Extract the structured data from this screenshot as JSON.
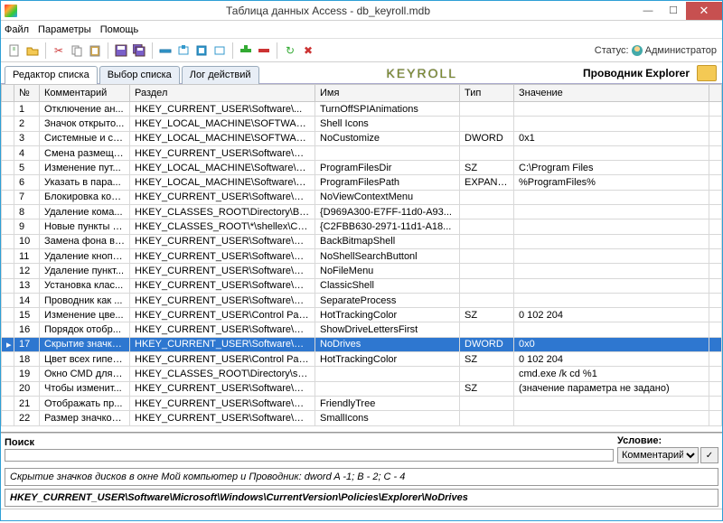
{
  "window": {
    "title": "Таблица данных Access - db_keyroll.mdb"
  },
  "menu": {
    "file": "Файл",
    "params": "Параметры",
    "help": "Помощь"
  },
  "status": {
    "label": "Статус:",
    "user": "Администратор"
  },
  "tabs": {
    "editor": "Редактор списка",
    "select": "Выбор списка",
    "log": "Лог действий"
  },
  "brand": "KEYROLL",
  "explorer_label": "Проводник Explorer",
  "columns": {
    "num": "№",
    "comment": "Комментарий",
    "section": "Раздел",
    "name": "Имя",
    "type": "Тип",
    "value": "Значение"
  },
  "rows": [
    {
      "n": "1",
      "com": "Отключение ан...",
      "sec": "HKEY_CURRENT_USER\\Software\\...",
      "name": "TurnOffSPIAnimations",
      "type": "",
      "val": ""
    },
    {
      "n": "2",
      "com": "Значок открыто...",
      "sec": "HKEY_LOCAL_MACHINE\\SOFTWARE\\...",
      "name": "Shell Icons",
      "type": "",
      "val": ""
    },
    {
      "n": "3",
      "com": "Системные и сп...",
      "sec": "HKEY_LOCAL_MACHINE\\SOFTWARE\\...",
      "name": "NoCustomize",
      "type": "DWORD",
      "val": "0x1"
    },
    {
      "n": "4",
      "com": "Смена размеще...",
      "sec": "HKEY_CURRENT_USER\\Software\\Mic...",
      "name": "",
      "type": "",
      "val": ""
    },
    {
      "n": "5",
      "com": "Изменение пут...",
      "sec": "HKEY_LOCAL_MACHINE\\Software\\Mic...",
      "name": "ProgramFilesDir",
      "type": "SZ",
      "val": "C:\\Program Files"
    },
    {
      "n": "6",
      "com": "Указать в пара...",
      "sec": "HKEY_LOCAL_MACHINE\\Software\\Mic...",
      "name": "ProgramFilesPath",
      "type": "EXPAND...",
      "val": "%ProgramFiles%"
    },
    {
      "n": "7",
      "com": "Блокировка кон...",
      "sec": "HKEY_CURRENT_USER\\Software\\Mic...",
      "name": "NoViewContextMenu",
      "type": "",
      "val": ""
    },
    {
      "n": "8",
      "com": "Удаление кома...",
      "sec": "HKEY_CLASSES_ROOT\\Directory\\Bac...",
      "name": "{D969A300-E7FF-11d0-A93...",
      "type": "",
      "val": ""
    },
    {
      "n": "9",
      "com": "Новые пункты К...",
      "sec": "HKEY_CLASSES_ROOT\\*\\shellex\\Cont...",
      "name": "{C2FBB630-2971-11d1-A18...",
      "type": "",
      "val": ""
    },
    {
      "n": "10",
      "com": "Замена фона в ...",
      "sec": "HKEY_CURRENT_USER\\Software\\Mic...",
      "name": "BackBitmapShell",
      "type": "",
      "val": ""
    },
    {
      "n": "11",
      "com": "Удаление кнопк...",
      "sec": "HKEY_CURRENT_USER\\Software\\Mic...",
      "name": "NoShellSearchButtonl",
      "type": "",
      "val": ""
    },
    {
      "n": "12",
      "com": "Удаление пункт...",
      "sec": "HKEY_CURRENT_USER\\Software\\Mic...",
      "name": "NoFileMenu",
      "type": "",
      "val": ""
    },
    {
      "n": "13",
      "com": "Установка клас...",
      "sec": "HKEY_CURRENT_USER\\Software\\Mic...",
      "name": "ClassicShell",
      "type": "",
      "val": ""
    },
    {
      "n": "14",
      "com": "Проводник как ...",
      "sec": "HKEY_CURRENT_USER\\Software\\Mic...",
      "name": "SeparateProcess",
      "type": "",
      "val": ""
    },
    {
      "n": "15",
      "com": "Изменение цве...",
      "sec": "HKEY_CURRENT_USER\\Control Pane...",
      "name": "HotTrackingColor",
      "type": "SZ",
      "val": "0 102 204"
    },
    {
      "n": "16",
      "com": "Порядок отобр...",
      "sec": "HKEY_CURRENT_USER\\Software\\Mic...",
      "name": "ShowDriveLettersFirst",
      "type": "",
      "val": ""
    },
    {
      "n": "17",
      "com": "Скрытие значко...",
      "sec": "HKEY_CURRENT_USER\\Software\\Mic...",
      "name": "NoDrives",
      "type": "DWORD",
      "val": "0x0",
      "selected": true
    },
    {
      "n": "18",
      "com": "Цвет всех гипер...",
      "sec": "HKEY_CURRENT_USER\\Control Pane...",
      "name": "HotTrackingColor",
      "type": "SZ",
      "val": "0 102 204"
    },
    {
      "n": "19",
      "com": "Окно CMD для к...",
      "sec": "HKEY_CLASSES_ROOT\\Directory\\she...",
      "name": "",
      "type": "",
      "val": "cmd.exe /k cd %1"
    },
    {
      "n": "20",
      "com": "Чтобы изменит...",
      "sec": "HKEY_CURRENT_USER\\Software\\Mic...",
      "name": "",
      "type": "SZ",
      "val": "(значение параметра не задано)"
    },
    {
      "n": "21",
      "com": "Отображать пр...",
      "sec": "HKEY_CURRENT_USER\\Software\\Mic...",
      "name": "FriendlyTree",
      "type": "",
      "val": ""
    },
    {
      "n": "22",
      "com": "Размер значков...",
      "sec": "HKEY_CURRENT_USER\\Software\\Mic...",
      "name": "SmallIcons",
      "type": "",
      "val": ""
    }
  ],
  "search": {
    "label": "Поиск",
    "placeholder": "",
    "condition_label": "Условие:",
    "condition_value": "Комментарий",
    "go": "✓"
  },
  "info1": "Скрытие значков дисков в окне Мой компьютер и Проводник: dword A -1; B - 2; C - 4",
  "info2": "HKEY_CURRENT_USER\\Software\\Microsoft\\Windows\\CurrentVersion\\Policies\\Explorer\\NoDrives"
}
